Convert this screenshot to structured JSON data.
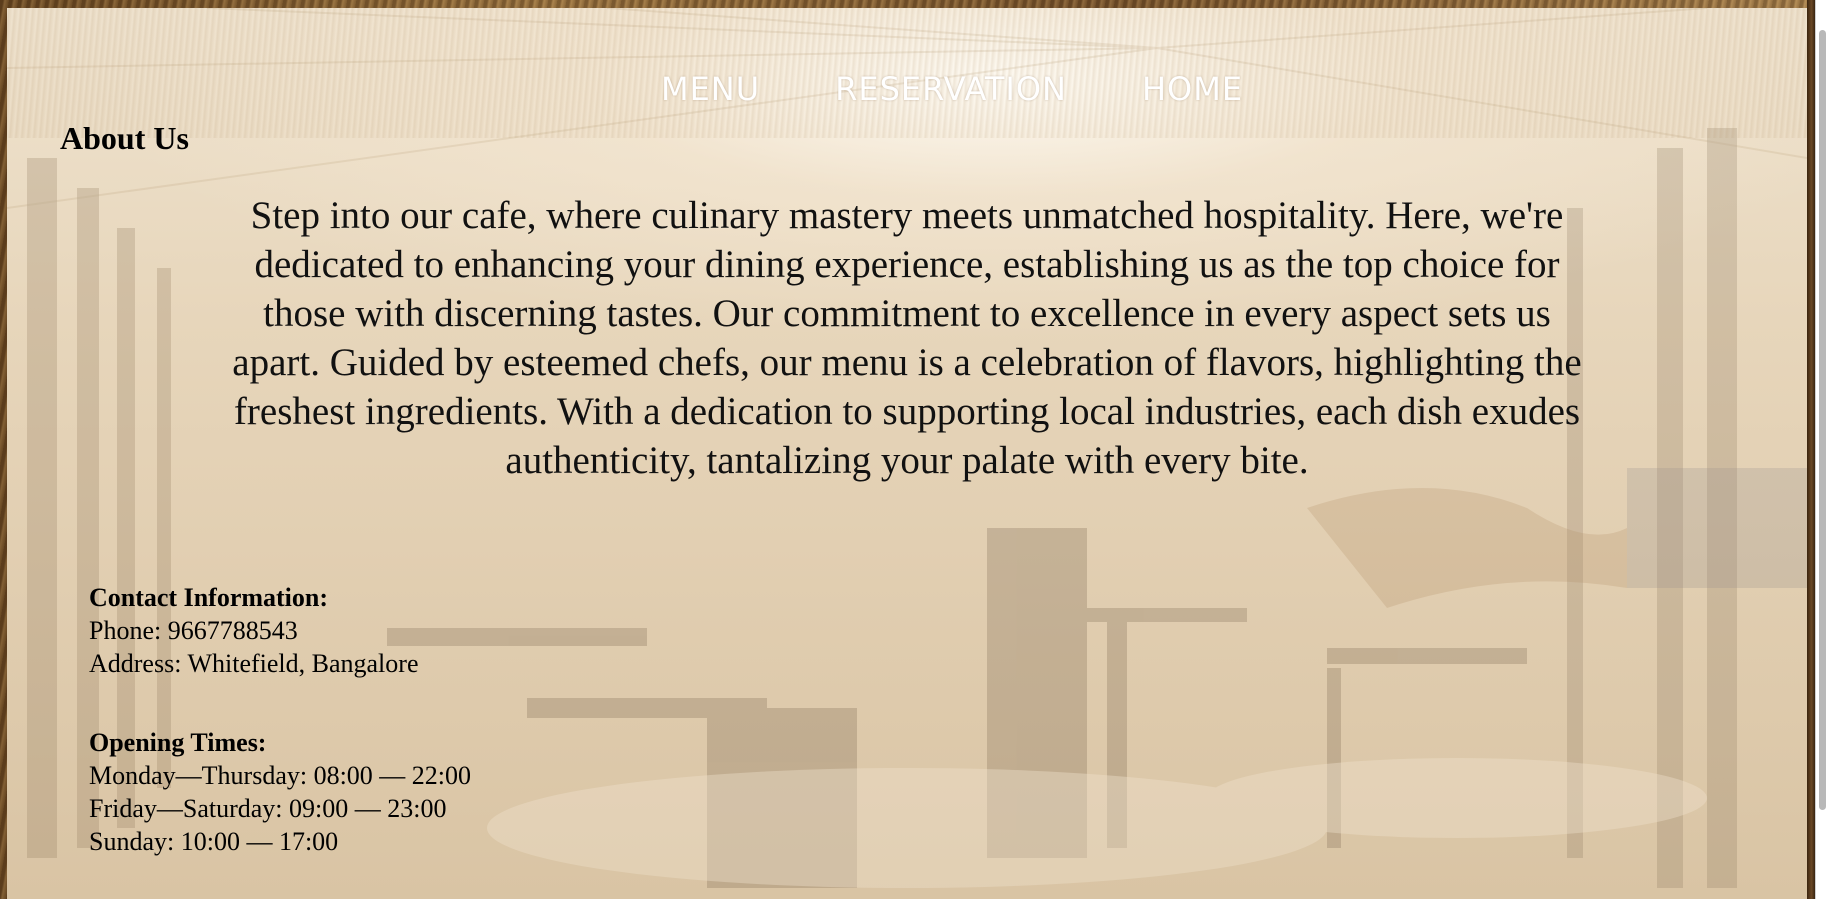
{
  "nav": {
    "items": [
      {
        "label": "MENU"
      },
      {
        "label": "RESERVATION"
      },
      {
        "label": "HOME"
      }
    ]
  },
  "about": {
    "heading": "About Us",
    "text": "Step into our cafe, where culinary mastery meets unmatched hospitality. Here, we're dedicated to enhancing your dining experience, establishing us as the top choice for those with discerning tastes. Our commitment to excellence in every aspect sets us apart. Guided by esteemed chefs, our menu is a celebration of flavors, highlighting the freshest ingredients. With a dedication to supporting local industries, each dish exudes authenticity, tantalizing your palate with every bite."
  },
  "contact": {
    "label": "Contact Information:",
    "phone": "Phone: 9667788543",
    "address": "Address: Whitefield, Bangalore"
  },
  "hours": {
    "label": "Opening Times:",
    "lines": [
      "Monday—Thursday: 08:00 — 22:00",
      "Friday—Saturday: 09:00 — 23:00",
      "Sunday: 10:00 — 17:00"
    ]
  },
  "colors": {
    "nav_text": "#ffffff",
    "body_text": "#000000",
    "panel_bg": "#e7d6bb"
  }
}
